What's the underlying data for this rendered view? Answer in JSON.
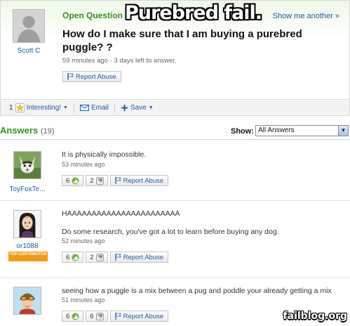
{
  "header": {
    "status_label": "Open Question",
    "meme_title": "Purebred fail.",
    "show_another": "Show me another »"
  },
  "question": {
    "asker_name": "Scott C",
    "title": "How do I make sure that I am buying a purebred puggle? ?",
    "meta": "59 minutes ago - 3 days left to answer.",
    "report_label": "Report Abuse"
  },
  "actions": {
    "interesting_count": "1",
    "interesting_label": "Interesting!",
    "email_label": "Email",
    "save_label": "Save"
  },
  "answers_header": {
    "title": "Answers",
    "count": "(19)",
    "show_label": "Show:",
    "show_value": "All Answers"
  },
  "answers": [
    {
      "name": "ToyFoxTe...",
      "lines": [
        "It is physically impossible."
      ],
      "time": "53 minutes ago",
      "thumbs_up": "6",
      "thumbs_down": "2",
      "report_label": "Report Abuse",
      "top_contributor": ""
    },
    {
      "name": "or1088",
      "lines": [
        "HAAAAAAAAAAAAAAAAAAAAAAA",
        "Do some research, you've got a lot to learn before buying any dog."
      ],
      "time": "52 minutes ago",
      "thumbs_up": "6",
      "thumbs_down": "2",
      "report_label": "Report Abuse",
      "top_contributor": "TOP CONTRIBUTOR"
    },
    {
      "name": "",
      "lines": [
        "seeing how a puggle is a mix between a pug and poddle your already getting a mix"
      ],
      "time": "51 minutes ago",
      "thumbs_up": "6",
      "thumbs_down": "6",
      "report_label": "Report Abuse",
      "top_contributor": ""
    }
  ],
  "watermark": "failblog.org",
  "colors": {
    "brand_green": "#3a8d1c",
    "link_blue": "#1a5aa8",
    "top_contributor_orange": "#f29a17"
  }
}
